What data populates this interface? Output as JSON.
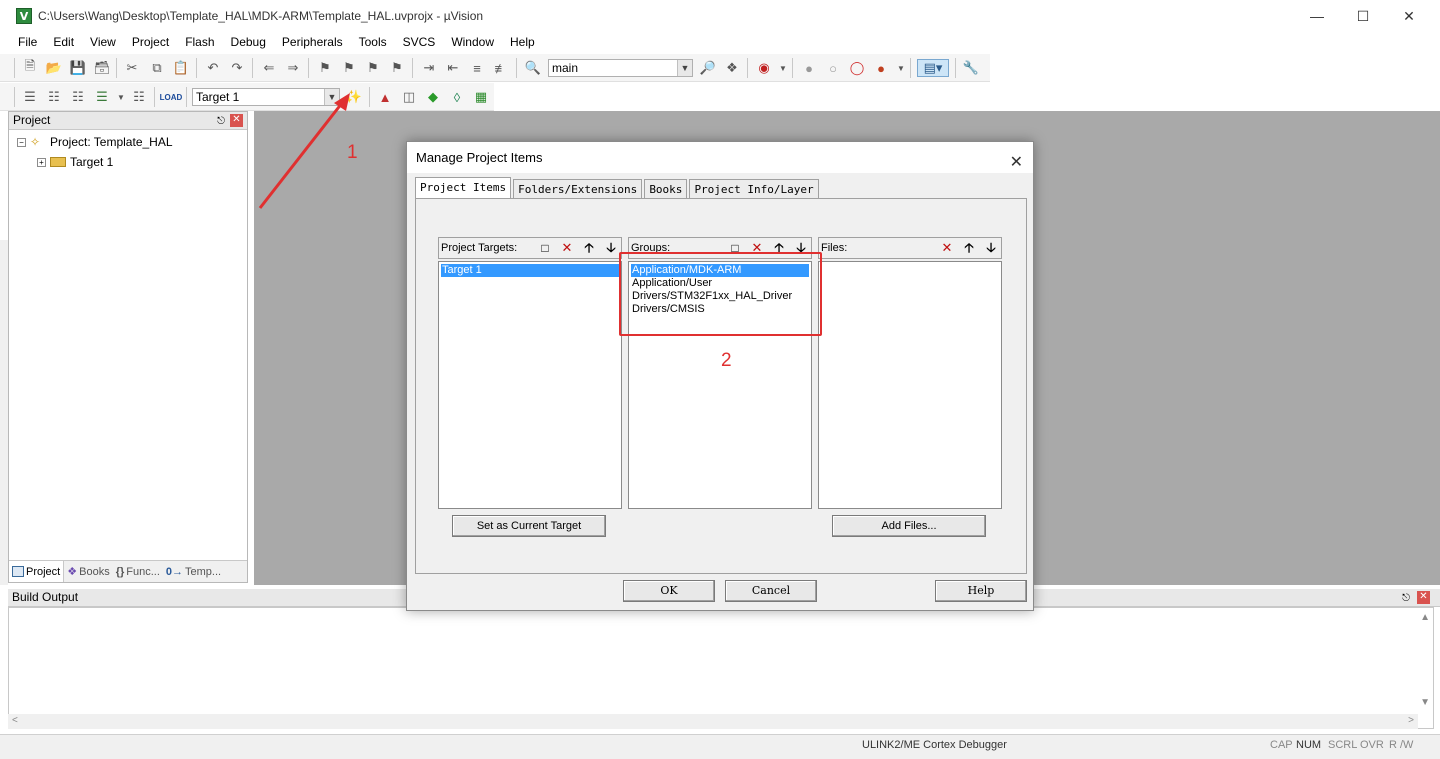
{
  "window": {
    "title": "C:\\Users\\Wang\\Desktop\\Template_HAL\\MDK-ARM\\Template_HAL.uvprojx - µVision",
    "app_icon": "V"
  },
  "menu": [
    "File",
    "Edit",
    "View",
    "Project",
    "Flash",
    "Debug",
    "Peripherals",
    "Tools",
    "SVCS",
    "Window",
    "Help"
  ],
  "toolbar1": {
    "search_combo": "main"
  },
  "toolbar2": {
    "target_combo": "Target 1"
  },
  "project_panel": {
    "title": "Project",
    "tree": {
      "root": "Project: Template_HAL",
      "child": "Target 1"
    },
    "tabs": [
      "Project",
      "Books",
      "Func...",
      "Temp..."
    ]
  },
  "build_output": {
    "title": "Build Output"
  },
  "statusbar": {
    "debugger": "ULINK2/ME Cortex Debugger",
    "cap": "CAP",
    "num": "NUM",
    "scrl": "SCRL",
    "ovr": "OVR",
    "rw": "R /W"
  },
  "annotations": {
    "one": "1",
    "two": "2",
    "color": "#e03030"
  },
  "dialog": {
    "title": "Manage Project Items",
    "tabs": [
      "Project Items",
      "Folders/Extensions",
      "Books",
      "Project Info/Layer"
    ],
    "targets": {
      "label": "Project Targets:",
      "items": [
        "Target 1"
      ]
    },
    "groups": {
      "label": "Groups:",
      "items": [
        "Application/MDK-ARM",
        "Application/User",
        "Drivers/STM32F1xx_HAL_Driver",
        "Drivers/CMSIS"
      ]
    },
    "files": {
      "label": "Files:",
      "items": []
    },
    "set_current_target": "Set as Current Target",
    "add_files": "Add Files...",
    "ok": "OK",
    "cancel": "Cancel",
    "help": "Help"
  },
  "colors": {
    "selection": "#3399ff",
    "workspace": "#a9a9a9",
    "annotation": "#e03030"
  }
}
